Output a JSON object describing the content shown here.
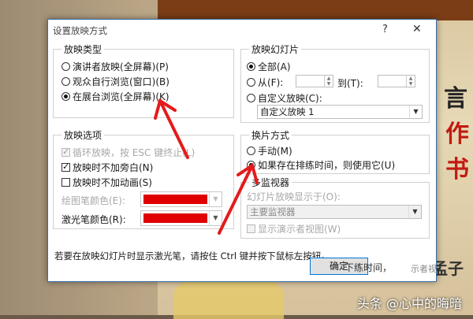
{
  "dialog": {
    "title": "设置放映方式",
    "help_glyph": "?",
    "close_glyph": "✕"
  },
  "show_type": {
    "legend": "放映类型",
    "options": [
      {
        "label": "演讲者放映(全屏幕)(P)",
        "selected": false
      },
      {
        "label": "观众自行浏览(窗口)(B)",
        "selected": false
      },
      {
        "label": "在展台浏览(全屏幕)(K)",
        "selected": true
      }
    ]
  },
  "show_slides": {
    "legend": "放映幻灯片",
    "all_label": "全部(A)",
    "from_label": "从(F):",
    "to_label": "到(T):",
    "from_value": "",
    "to_value": "",
    "custom_label": "自定义放映(C):",
    "custom_value": "自定义放映 1"
  },
  "show_options": {
    "legend": "放映选项",
    "loop_label": "循环放映，按 ESC 键终止(L)",
    "no_narration_label": "放映时不加旁白(N)",
    "no_animation_label": "放映时不加动画(S)",
    "pen_color_label": "绘图笔颜色(E):",
    "laser_color_label": "激光笔颜色(R):",
    "pen_color": "#e00000",
    "laser_color": "#e00000"
  },
  "advance": {
    "legend": "换片方式",
    "manual_label": "手动(M)",
    "timings_label": "如果存在排练时间，则使用它(U)"
  },
  "monitors": {
    "legend": "多监视器",
    "display_on_label": "幻灯片放映显示于(O):",
    "display_value": "主要监视器",
    "presenter_view_label": "显示演示者视图(W)"
  },
  "hint": "若要在放映幻灯片时显示激光笔，请按住 Ctrl 键并按下鼠标左按钮。",
  "buttons": {
    "ok": "确定",
    "background_fragment": "下练时间，",
    "background_fragment_2": "示者视"
  },
  "slide": {
    "chars": [
      "言",
      "作",
      "书"
    ],
    "bottom_fragment": "孟子"
  },
  "watermark": "头条 @心中的晦暗"
}
